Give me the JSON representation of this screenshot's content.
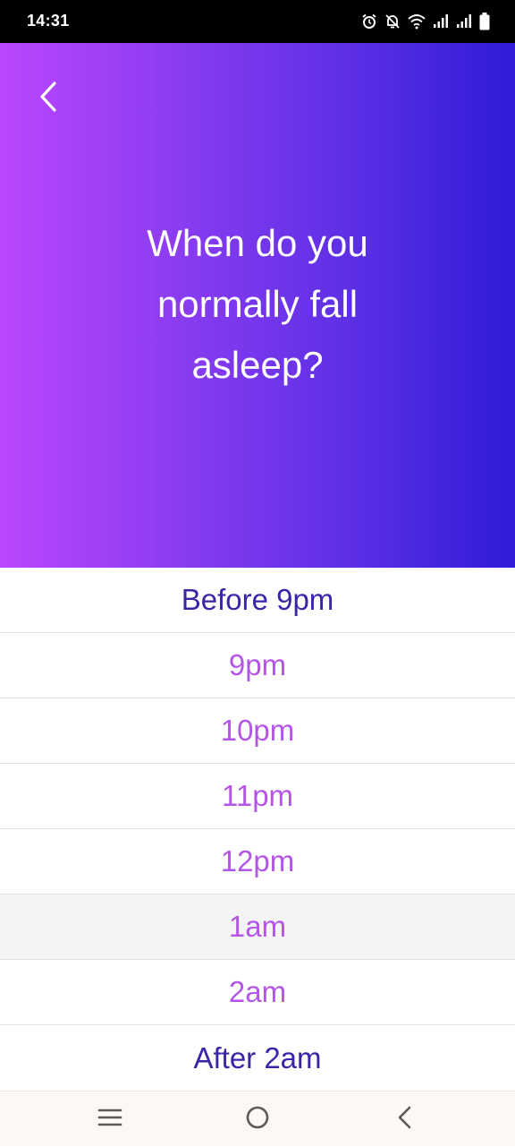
{
  "status_bar": {
    "time": "14:31",
    "icons": [
      "alarm-icon",
      "notifications-off-icon",
      "wifi-icon",
      "signal-icon",
      "signal-icon",
      "battery-icon"
    ]
  },
  "header": {
    "back_icon": "chevron-left-icon",
    "question": "When do you normally fall asleep?",
    "gradient": [
      "#bb46ff",
      "#2f1bd8"
    ]
  },
  "options": [
    {
      "label": "Before 9pm"
    },
    {
      "label": "9pm"
    },
    {
      "label": "10pm"
    },
    {
      "label": "11pm"
    },
    {
      "label": "12pm"
    },
    {
      "label": "1am"
    },
    {
      "label": "2am"
    },
    {
      "label": "After 2am"
    }
  ],
  "colors": {
    "option_primary": "#3a25a6",
    "option_secondary": "#b455e8",
    "highlight_row": "#f4f4f4"
  },
  "nav_bar": {
    "icons": [
      "menu-icon",
      "home-icon",
      "back-icon"
    ]
  }
}
